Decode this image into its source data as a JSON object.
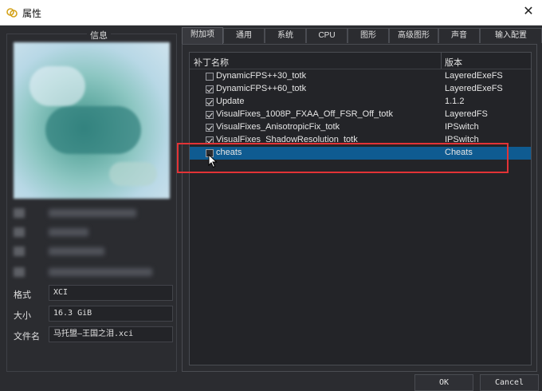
{
  "window": {
    "title": "属性",
    "close_glyph": "✕"
  },
  "info": {
    "legend": "信息",
    "blurred_labels": [
      "名",
      "开",
      "版",
      "更"
    ],
    "format_label": "格式",
    "format_value": "XCI",
    "size_label": "大小",
    "size_value": "16.3 GiB",
    "filename_label": "文件名",
    "filename_value": "马托盟—王国之泪.xci"
  },
  "tabs": [
    {
      "label": "附加项",
      "active": true
    },
    {
      "label": "通用",
      "active": false
    },
    {
      "label": "系统",
      "active": false
    },
    {
      "label": "CPU",
      "active": false
    },
    {
      "label": "图形",
      "active": false
    },
    {
      "label": "高级图形",
      "active": false
    },
    {
      "label": "声音",
      "active": false
    },
    {
      "label": "输入配置",
      "active": false
    }
  ],
  "addons": {
    "col_name": "补丁名称",
    "col_version": "版本",
    "rows": [
      {
        "name": "DynamicFPS++30_totk",
        "version": "LayeredExeFS",
        "checked": false,
        "selected": false
      },
      {
        "name": "DynamicFPS++60_totk",
        "version": "LayeredExeFS",
        "checked": true,
        "selected": false
      },
      {
        "name": "Update",
        "version": "1.1.2",
        "checked": true,
        "selected": false
      },
      {
        "name": "VisualFixes_1008P_FXAA_Off_FSR_Off_totk",
        "version": "LayeredFS",
        "checked": true,
        "selected": false
      },
      {
        "name": "VisualFixes_AnisotropicFix_totk",
        "version": "IPSwitch",
        "checked": true,
        "selected": false
      },
      {
        "name": "VisualFixes_ShadowResolution_totk",
        "version": "IPSwitch",
        "checked": true,
        "selected": false
      },
      {
        "name": "cheats",
        "version": "Cheats",
        "checked": false,
        "selected": true
      }
    ]
  },
  "buttons": {
    "ok": "OK",
    "cancel": "Cancel"
  },
  "colors": {
    "highlight_box": "#e23336",
    "selection": "#0f5b91",
    "background": "#2b2c30"
  }
}
